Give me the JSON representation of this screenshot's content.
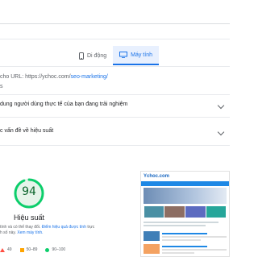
{
  "tabs": [
    {
      "label": "Di động",
      "icon": "mobile-phone-icon",
      "active": false
    },
    {
      "label": "Máy tính",
      "icon": "desktop-monitor-icon",
      "active": true
    }
  ],
  "report": {
    "url_prefix": "cho URL: https://ychoc.com/",
    "url_link": "seo-marketing/",
    "partial_letter": "s"
  },
  "sections": {
    "field_data_title": "dung người dùng thực tế của bạn đang trải nghiệm",
    "diagnose_title": "c vấn đề về hiệu suất"
  },
  "performance": {
    "score": "94",
    "label": "Hiệu suất",
    "note_prefix": "tính và có thể thay đổi.",
    "note_link1": "Điểm hiệu quả được tính",
    "note_suffix": "trực",
    "note_line2_prefix": "h số này.",
    "note_link2": "Xem máy tính."
  },
  "legend": [
    {
      "range": "49",
      "shape": "triangle",
      "color": "#ff4e42"
    },
    {
      "range": "50–89",
      "shape": "square",
      "color": "#ffa400"
    },
    {
      "range": "90–100",
      "shape": "circle",
      "color": "#0cce6b"
    }
  ],
  "screenshot": {
    "site_name": "Ychoc.com"
  },
  "colors": {
    "accent": "#1a73e8",
    "pass_green": "#0cce6b",
    "score_text": "#0d652d"
  }
}
